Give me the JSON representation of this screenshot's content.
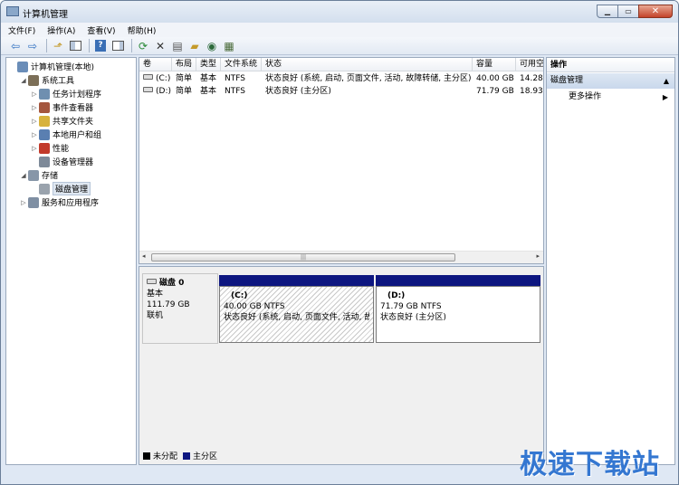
{
  "window": {
    "title": "计算机管理"
  },
  "menu": [
    "文件(F)",
    "操作(A)",
    "查看(V)",
    "帮助(H)"
  ],
  "toolbar": {
    "icons": [
      "back-icon",
      "forward-icon",
      "up-folder-icon",
      "show-hide-tree-icon",
      "help-icon",
      "properties-icon",
      "refresh-icon",
      "delete-icon",
      "connect-icon",
      "open-folder-icon",
      "search-icon",
      "options-icon"
    ]
  },
  "tree": {
    "items": [
      {
        "label": "计算机管理(本地)",
        "level": 0,
        "toggle": "",
        "icon": "computer-management-icon",
        "color": "#6a8db8"
      },
      {
        "label": "系统工具",
        "level": 1,
        "toggle": "◢",
        "icon": "system-tools-icon",
        "color": "#7c6f58"
      },
      {
        "label": "任务计划程序",
        "level": 2,
        "toggle": "▷",
        "icon": "task-scheduler-icon",
        "color": "#6f8fb0"
      },
      {
        "label": "事件查看器",
        "level": 2,
        "toggle": "▷",
        "icon": "event-viewer-icon",
        "color": "#a4563e"
      },
      {
        "label": "共享文件夹",
        "level": 2,
        "toggle": "▷",
        "icon": "shared-folders-icon",
        "color": "#d7b23d"
      },
      {
        "label": "本地用户和组",
        "level": 2,
        "toggle": "▷",
        "icon": "local-users-icon",
        "color": "#5a7fb1"
      },
      {
        "label": "性能",
        "level": 2,
        "toggle": "▷",
        "icon": "performance-icon",
        "color": "#c23a2b"
      },
      {
        "label": "设备管理器",
        "level": 2,
        "toggle": "",
        "icon": "device-manager-icon",
        "color": "#7e8a99"
      },
      {
        "label": "存储",
        "level": 1,
        "toggle": "◢",
        "icon": "storage-icon",
        "color": "#8796a8"
      },
      {
        "label": "磁盘管理",
        "level": 2,
        "toggle": "",
        "icon": "disk-management-icon",
        "color": "#9aa3ad",
        "selected": true
      },
      {
        "label": "服务和应用程序",
        "level": 1,
        "toggle": "▷",
        "icon": "services-apps-icon",
        "color": "#7f8fa3"
      }
    ]
  },
  "volumes": {
    "columns": [
      "卷",
      "布局",
      "类型",
      "文件系统",
      "状态",
      "容量",
      "可用空"
    ],
    "rows": [
      {
        "volume": "(C:)",
        "layout": "简单",
        "type": "基本",
        "fs": "NTFS",
        "status": "状态良好 (系统, 启动, 页面文件, 活动, 故障转储, 主分区)",
        "capacity": "40.00 GB",
        "free": "14.28"
      },
      {
        "volume": "(D:)",
        "layout": "简单",
        "type": "基本",
        "fs": "NTFS",
        "status": "状态良好 (主分区)",
        "capacity": "71.79 GB",
        "free": "18.93"
      }
    ]
  },
  "disk": {
    "name": "磁盘 0",
    "type": "基本",
    "size": "111.79 GB",
    "state": "联机",
    "partitions": [
      {
        "label": "(C:)",
        "size": "40.00 GB NTFS",
        "status": "状态良好 (系统, 启动, 页面文件, 活动, 故",
        "hatched": true
      },
      {
        "label": "(D:)",
        "size": "71.79 GB NTFS",
        "status": "状态良好 (主分区)",
        "hatched": false
      }
    ]
  },
  "legend": [
    {
      "label": "未分配",
      "color": "#000000"
    },
    {
      "label": "主分区",
      "color": "#0d1680"
    }
  ],
  "actions": {
    "header": "操作",
    "section": "磁盘管理",
    "more": "更多操作"
  },
  "watermark": "极速下载站"
}
